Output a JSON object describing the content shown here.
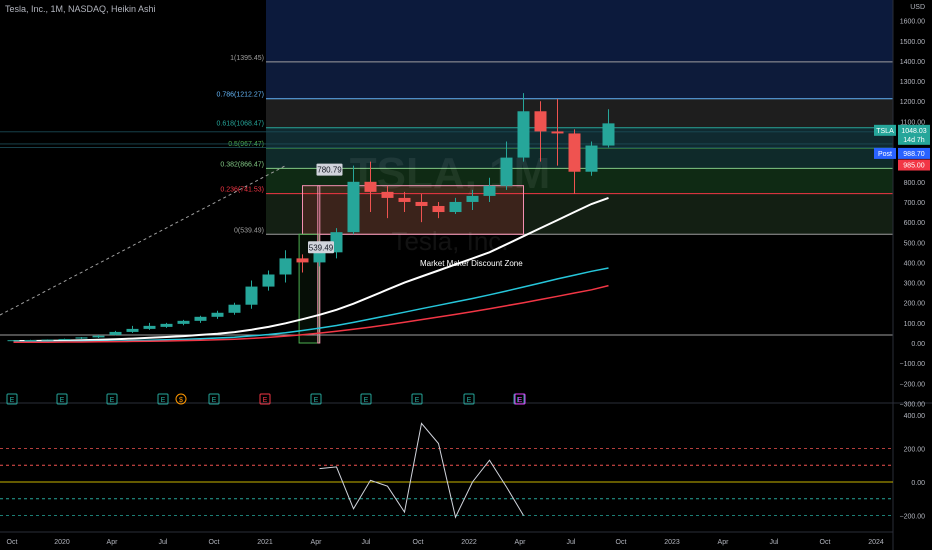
{
  "header": {
    "title": "Tesla, Inc., 1M, NASDAQ, Heikin Ashi"
  },
  "watermark": {
    "symbol": "TSLA, 1M",
    "company": "Tesla, Inc."
  },
  "currency": "USD",
  "price_axis": {
    "labels": [
      "1600.00",
      "1500.00",
      "1400.00",
      "1300.00",
      "1200.00",
      "1100.00",
      "1000.00",
      "900.00",
      "800.00",
      "700.00",
      "600.00",
      "500.00",
      "400.00",
      "300.00",
      "200.00",
      "100.00",
      "0.00",
      "−100.00",
      "−200.00",
      "−300.00"
    ],
    "values": [
      1600,
      1500,
      1400,
      1300,
      1200,
      1100,
      1000,
      900,
      800,
      700,
      600,
      500,
      400,
      300,
      200,
      100,
      0,
      -100,
      -200,
      -300
    ]
  },
  "price_tags": [
    {
      "text": "TSLA",
      "value": "1048.03",
      "sub": "14d 7h",
      "color": "#26a69a"
    },
    {
      "text": "Post",
      "value": "988.70",
      "color": "#2962ff"
    },
    {
      "text": "",
      "value": "985.00",
      "color": "#f23645"
    }
  ],
  "fib_levels": [
    {
      "label": "1(1395.45)",
      "price": 1395.45,
      "color": "#9e9e9e"
    },
    {
      "label": "0.786(1212.27)",
      "price": 1212.27,
      "color": "#64b5f6"
    },
    {
      "label": "0.618(1068.47)",
      "price": 1068.47,
      "color": "#26a69a"
    },
    {
      "label": "0.5(967.47)",
      "price": 967.47,
      "color": "#4caf50"
    },
    {
      "label": "0.382(866.47)",
      "price": 866.47,
      "color": "#81c784"
    },
    {
      "label": "0.236(741.53)",
      "price": 741.53,
      "color": "#f23645"
    },
    {
      "label": "0(539.49)",
      "price": 539.49,
      "color": "#9e9e9e"
    }
  ],
  "callouts": [
    {
      "text": "780.79",
      "price": 780.79
    },
    {
      "text": "539.49",
      "price": 539.49
    }
  ],
  "zone_label": "Market Maker Discount Zone",
  "time_axis": [
    "Oct",
    "2020",
    "Apr",
    "Jul",
    "Oct",
    "2021",
    "Apr",
    "Jul",
    "Oct",
    "2022",
    "Apr",
    "Jul",
    "Oct",
    "2023",
    "Apr",
    "Jul",
    "Oct",
    "2024"
  ],
  "event_markers": [
    {
      "glyph": "E",
      "kind": "earnings"
    },
    {
      "glyph": "E",
      "kind": "earnings"
    },
    {
      "glyph": "E",
      "kind": "earnings"
    },
    {
      "glyph": "E",
      "kind": "earnings"
    },
    {
      "glyph": "$",
      "kind": "dividend"
    },
    {
      "glyph": "E",
      "kind": "earnings"
    },
    {
      "glyph": "E",
      "kind": "earnings-red"
    },
    {
      "glyph": "E",
      "kind": "earnings"
    },
    {
      "glyph": "E",
      "kind": "earnings"
    },
    {
      "glyph": "E",
      "kind": "earnings"
    },
    {
      "glyph": "E",
      "kind": "earnings"
    },
    {
      "glyph": "E",
      "kind": "earnings"
    },
    {
      "glyph": "E",
      "kind": "earnings-pink"
    }
  ],
  "oscillator_axis": {
    "labels": [
      "400.00",
      "200.00",
      "0.00",
      "−200.00"
    ],
    "values": [
      400,
      200,
      0,
      -200
    ]
  },
  "chart_data": {
    "type": "candlestick",
    "title": "Tesla, Inc., 1M, NASDAQ, Heikin Ashi",
    "x_start": "2019-09",
    "ylim": [
      -300,
      1700
    ],
    "candles": [
      [
        14,
        15,
        13,
        14
      ],
      [
        15,
        16,
        13,
        15
      ],
      [
        16,
        18,
        15,
        17
      ],
      [
        18,
        22,
        17,
        20
      ],
      [
        22,
        30,
        20,
        28
      ],
      [
        28,
        40,
        25,
        36
      ],
      [
        40,
        60,
        38,
        55
      ],
      [
        55,
        85,
        50,
        70
      ],
      [
        70,
        100,
        65,
        85
      ],
      [
        80,
        100,
        75,
        95
      ],
      [
        95,
        115,
        88,
        110
      ],
      [
        110,
        135,
        100,
        130
      ],
      [
        130,
        160,
        120,
        150
      ],
      [
        150,
        200,
        140,
        190
      ],
      [
        190,
        310,
        170,
        280
      ],
      [
        280,
        360,
        260,
        340
      ],
      [
        340,
        460,
        300,
        420
      ],
      [
        420,
        440,
        350,
        400
      ],
      [
        400,
        470,
        380,
        450
      ],
      [
        450,
        570,
        420,
        550
      ],
      [
        550,
        880,
        540,
        800
      ],
      [
        800,
        900,
        650,
        750
      ],
      [
        750,
        780,
        620,
        720
      ],
      [
        720,
        750,
        650,
        700
      ],
      [
        700,
        740,
        600,
        680
      ],
      [
        680,
        700,
        620,
        650
      ],
      [
        650,
        720,
        640,
        700
      ],
      [
        700,
        760,
        660,
        730
      ],
      [
        730,
        820,
        700,
        780
      ],
      [
        780,
        1000,
        760,
        920
      ],
      [
        920,
        1240,
        900,
        1150
      ],
      [
        1150,
        1200,
        900,
        1050
      ],
      [
        1050,
        1210,
        880,
        1040
      ],
      [
        1040,
        1060,
        740,
        850
      ],
      [
        850,
        1000,
        830,
        980
      ],
      [
        980,
        1160,
        970,
        1090
      ]
    ],
    "zone_band": [
      539.49,
      780.79
    ],
    "moving_averages": [
      {
        "color": "#ffffff",
        "values": [
          10,
          10,
          11,
          12,
          14,
          16,
          19,
          22,
          26,
          30,
          34,
          40,
          46,
          54,
          66,
          80,
          98,
          118,
          140,
          165,
          195,
          230,
          265,
          300,
          330,
          360,
          390,
          420,
          450,
          490,
          530,
          570,
          610,
          650,
          690,
          720
        ]
      },
      {
        "color": "#26c6da",
        "values": [
          6,
          6,
          6,
          7,
          8,
          9,
          10,
          12,
          14,
          16,
          18,
          21,
          25,
          29,
          35,
          42,
          51,
          62,
          74,
          87,
          102,
          119,
          136,
          153,
          170,
          187,
          204,
          221,
          239,
          258,
          278,
          298,
          318,
          337,
          356,
          372
        ]
      },
      {
        "color": "#f23645",
        "values": [
          4,
          4,
          4,
          5,
          5,
          6,
          7,
          8,
          9,
          10,
          12,
          14,
          16,
          19,
          23,
          28,
          34,
          41,
          49,
          58,
          68,
          79,
          91,
          103,
          116,
          129,
          142,
          156,
          170,
          185,
          200,
          216,
          232,
          248,
          264,
          285
        ]
      }
    ],
    "oscillator": [
      80,
      90,
      -160,
      10,
      -25,
      -180,
      350,
      230,
      -210,
      0,
      130,
      -30,
      -200
    ]
  }
}
